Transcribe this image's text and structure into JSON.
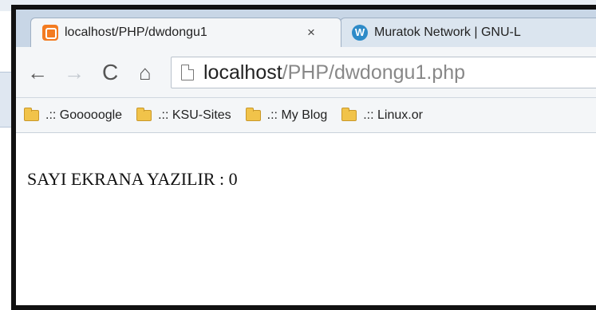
{
  "browser": {
    "tabs": [
      {
        "title": "localhost/PHP/dwdongu1",
        "icon": "xampp-icon",
        "close_label": "×",
        "active": true
      },
      {
        "title": "Muratok Network | GNU-L",
        "icon": "wordpress-icon",
        "active": false
      }
    ],
    "toolbar": {
      "back_label": "←",
      "forward_label": "→",
      "reload_label": "C",
      "home_label": "⌂",
      "url_host": "localhost",
      "url_path": "/PHP/dwdongu1.php"
    },
    "bookmarks": [
      {
        "label": ".:: Gooooogle",
        "icon": "folder-icon"
      },
      {
        "label": ".:: KSU-Sites",
        "icon": "folder-icon"
      },
      {
        "label": ".:: My Blog",
        "icon": "folder-icon"
      },
      {
        "label": ".:: Linux.or",
        "icon": "folder-icon"
      }
    ]
  },
  "page": {
    "text": "SAYI EKRANA YAZILIR : 0"
  }
}
